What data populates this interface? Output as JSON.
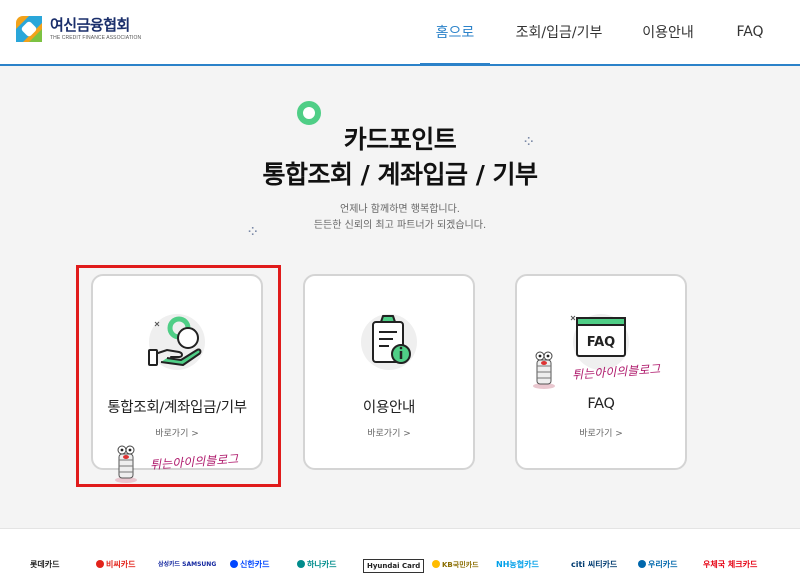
{
  "header": {
    "logo_name": "여신금융협회",
    "logo_subtitle": "THE CREDIT FINANCE ASSOCIATION",
    "nav": [
      {
        "label": "홈으로",
        "active": true
      },
      {
        "label": "조회/입금/기부",
        "active": false
      },
      {
        "label": "이용안내",
        "active": false
      },
      {
        "label": "FAQ",
        "active": false
      }
    ]
  },
  "hero": {
    "title_line1": "카드포인트",
    "title_line2": "통합조회 / 계좌입금 / 기부",
    "subtitle_line1": "언제나 함께하면 행복합니다.",
    "subtitle_line2": "든든한 신뢰의 최고 파트너가 되겠습니다."
  },
  "cards": [
    {
      "title": "통합조회/계좌입금/기부",
      "link": "바로가기 >",
      "icon": "hand-coin-icon"
    },
    {
      "title": "이용안내",
      "link": "바로가기 >",
      "icon": "clipboard-info-icon"
    },
    {
      "title": "FAQ",
      "link": "바로가기 >",
      "icon": "faq-board-icon"
    }
  ],
  "watermark": {
    "text": "튀는아이의블로그"
  },
  "footer": {
    "partners": [
      {
        "name": "롯데카드",
        "color": "#222222"
      },
      {
        "name": "비씨카드",
        "color": "#e2231a"
      },
      {
        "name": "삼성카드 SAMSUNG",
        "color": "#1428a0"
      },
      {
        "name": "신한카드",
        "color": "#0046ff"
      },
      {
        "name": "하나카드",
        "color": "#008c8c"
      },
      {
        "name": "Hyundai Card",
        "color": "#111111"
      },
      {
        "name": "KB국민카드",
        "color": "#ffbc00"
      },
      {
        "name": "NH농협카드",
        "color": "#00a0e9"
      },
      {
        "name": "citi 씨티카드",
        "color": "#003b70"
      },
      {
        "name": "우리카드",
        "color": "#0067ac"
      },
      {
        "name": "우체국 체크카드",
        "color": "#e60012"
      }
    ]
  },
  "colors": {
    "accent": "#2b82c9",
    "highlight": "#e01b1b",
    "green": "#4fce86"
  }
}
